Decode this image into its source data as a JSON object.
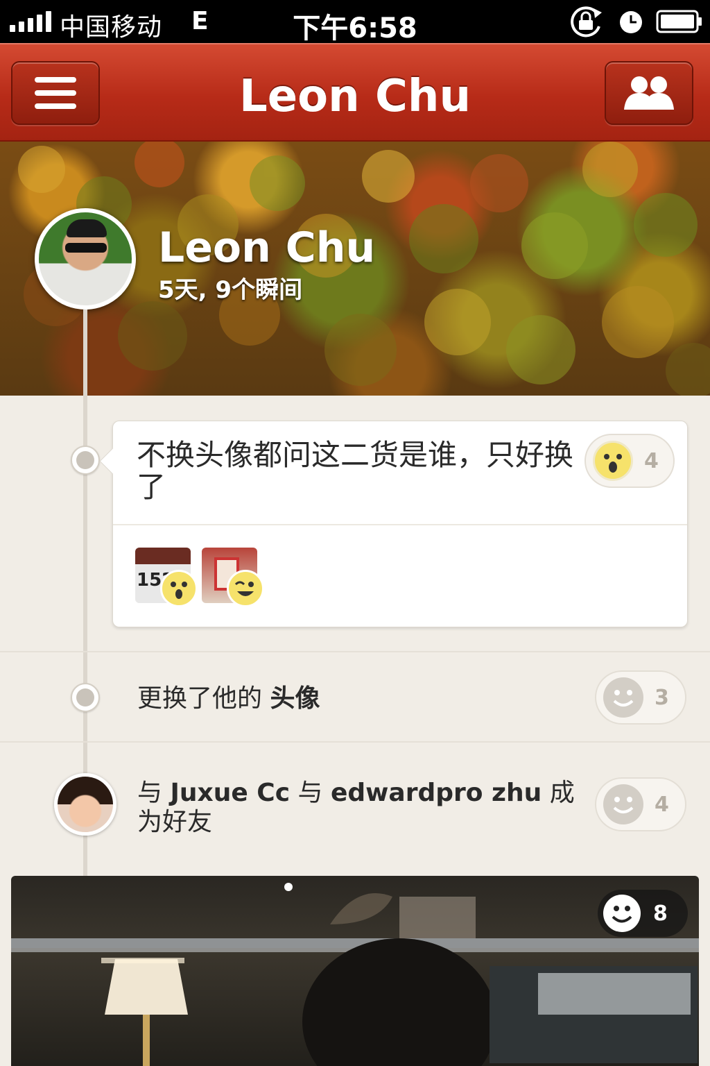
{
  "status_bar": {
    "carrier": "中国移动",
    "network": "E",
    "time": "下午6:58"
  },
  "nav": {
    "title": "Leon Chu",
    "menu_icon": "hamburger-menu-icon",
    "friends_icon": "friends-icon"
  },
  "profile": {
    "name": "Leon Chu",
    "stats": "5天, 9个瞬间"
  },
  "timeline": {
    "post": {
      "text": "不换头像都问这二货是谁，只好换了",
      "reaction_count": "4",
      "reaction_icon": "surprised-face-icon",
      "thumbnails": [
        {
          "emoji": "surprised-face-icon",
          "label": "15274"
        },
        {
          "emoji": "winking-face-icon"
        }
      ]
    },
    "avatar_change": {
      "text_prefix": "更换了他的",
      "text_bold": "头像",
      "reaction_count": "3"
    },
    "friendship": {
      "text_1": "与",
      "friend_1": "Juxue Cc",
      "text_2": "与",
      "friend_2": "edwardpro zhu",
      "text_3": "成为好友",
      "reaction_count": "4"
    },
    "photo": {
      "reaction_count": "8"
    }
  },
  "colors": {
    "nav_red": "#b72b18",
    "background": "#f1ede6",
    "smiley_yellow": "#f6e26b"
  }
}
